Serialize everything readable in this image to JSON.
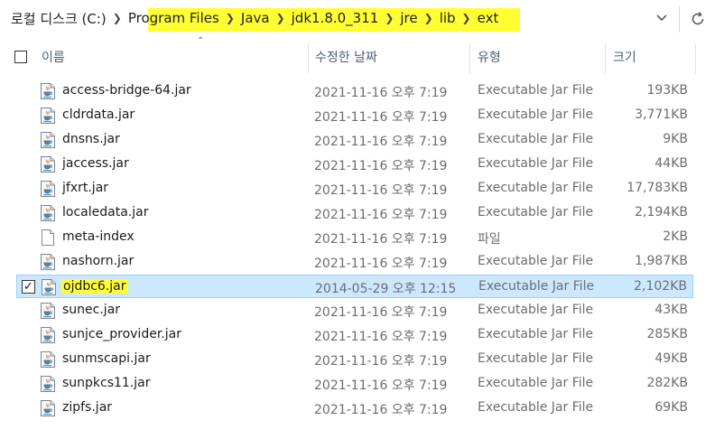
{
  "address": {
    "root": "로컬 디스크 (C:)",
    "crumbs": [
      "Program Files",
      "Java",
      "jdk1.8.0_311",
      "jre",
      "lib",
      "ext"
    ],
    "highlight_color": "#ffff33"
  },
  "columns": {
    "name": "이름",
    "date": "수정한 날짜",
    "type": "유형",
    "size": "크기"
  },
  "files": [
    {
      "name": "access-bridge-64.jar",
      "date": "2021-11-16 오후 7:19",
      "type": "Executable Jar File",
      "size": "193KB",
      "icon": "jar-file-icon"
    },
    {
      "name": "cldrdata.jar",
      "date": "2021-11-16 오후 7:19",
      "type": "Executable Jar File",
      "size": "3,771KB",
      "icon": "jar-file-icon"
    },
    {
      "name": "dnsns.jar",
      "date": "2021-11-16 오후 7:19",
      "type": "Executable Jar File",
      "size": "9KB",
      "icon": "jar-file-icon"
    },
    {
      "name": "jaccess.jar",
      "date": "2021-11-16 오후 7:19",
      "type": "Executable Jar File",
      "size": "44KB",
      "icon": "jar-file-icon"
    },
    {
      "name": "jfxrt.jar",
      "date": "2021-11-16 오후 7:19",
      "type": "Executable Jar File",
      "size": "17,783KB",
      "icon": "jar-file-icon"
    },
    {
      "name": "localedata.jar",
      "date": "2021-11-16 오후 7:19",
      "type": "Executable Jar File",
      "size": "2,194KB",
      "icon": "jar-file-icon"
    },
    {
      "name": "meta-index",
      "date": "2021-11-16 오후 7:19",
      "type": "파일",
      "size": "2KB",
      "icon": "blank-file-icon"
    },
    {
      "name": "nashorn.jar",
      "date": "2021-11-16 오후 7:19",
      "type": "Executable Jar File",
      "size": "1,987KB",
      "icon": "jar-file-icon"
    },
    {
      "name": "ojdbc6.jar",
      "date": "2014-05-29 오후 12:15",
      "type": "Executable Jar File",
      "size": "2,102KB",
      "icon": "jar-file-icon",
      "selected": true,
      "checked": true
    },
    {
      "name": "sunec.jar",
      "date": "2021-11-16 오후 7:19",
      "type": "Executable Jar File",
      "size": "43KB",
      "icon": "jar-file-icon"
    },
    {
      "name": "sunjce_provider.jar",
      "date": "2021-11-16 오후 7:19",
      "type": "Executable Jar File",
      "size": "285KB",
      "icon": "jar-file-icon"
    },
    {
      "name": "sunmscapi.jar",
      "date": "2021-11-16 오후 7:19",
      "type": "Executable Jar File",
      "size": "49KB",
      "icon": "jar-file-icon"
    },
    {
      "name": "sunpkcs11.jar",
      "date": "2021-11-16 오후 7:19",
      "type": "Executable Jar File",
      "size": "282KB",
      "icon": "jar-file-icon"
    },
    {
      "name": "zipfs.jar",
      "date": "2021-11-16 오후 7:19",
      "type": "Executable Jar File",
      "size": "69KB",
      "icon": "jar-file-icon"
    }
  ],
  "colors": {
    "selection_bg": "#cce8ff",
    "selection_border": "#99d1ff",
    "header_text": "#4c607a",
    "meta_text": "#6d6d6d"
  }
}
